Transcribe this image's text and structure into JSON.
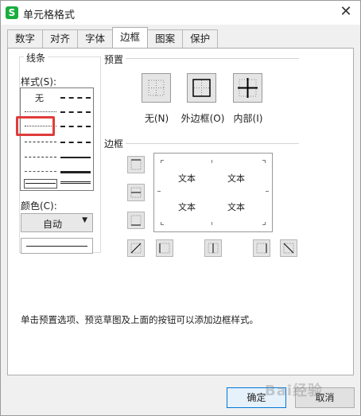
{
  "window": {
    "title": "单元格格式",
    "app_icon_glyph": "S",
    "close_glyph": "✕"
  },
  "tabs": [
    {
      "label": "数字",
      "active": false
    },
    {
      "label": "对齐",
      "active": false
    },
    {
      "label": "字体",
      "active": false
    },
    {
      "label": "边框",
      "active": true
    },
    {
      "label": "图案",
      "active": false
    },
    {
      "label": "保护",
      "active": false
    }
  ],
  "line_group": {
    "title": "线条",
    "style_label": "样式(S):",
    "none_label": "无",
    "color_label": "颜色(C):",
    "color_value": "自动",
    "dropdown_glyph": "▼"
  },
  "presets": {
    "title": "预置",
    "items": [
      {
        "label": "无(N)",
        "icon": "border-none-icon"
      },
      {
        "label": "外边框(O)",
        "icon": "border-outline-icon"
      },
      {
        "label": "内部(I)",
        "icon": "border-inside-icon"
      }
    ]
  },
  "border": {
    "title": "边框",
    "preview_cells": [
      "文本",
      "文本",
      "文本",
      "文本"
    ]
  },
  "hint": "单击预置选项、预览草图及上面的按钮可以添加边框样式。",
  "footer": {
    "ok_label": "确定",
    "cancel_label": "取消",
    "watermark": "Bai经验"
  },
  "colors": {
    "accent": "#0078d7",
    "highlight": "#e03b3b",
    "app_icon": "#1aad3f"
  }
}
